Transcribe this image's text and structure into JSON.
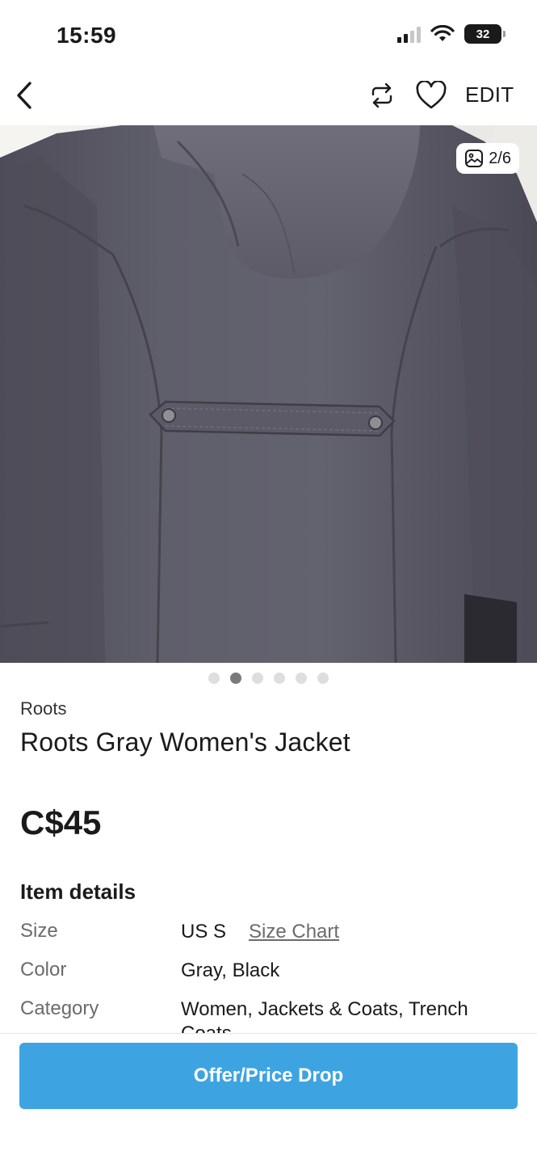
{
  "status_bar": {
    "time": "15:59",
    "battery": "32"
  },
  "nav": {
    "edit_label": "EDIT"
  },
  "gallery": {
    "counter": "2/6",
    "total_images": 6,
    "active_index": 2
  },
  "listing": {
    "brand": "Roots",
    "title": "Roots Gray Women's Jacket",
    "price": "C$45"
  },
  "item_details": {
    "title": "Item details",
    "size_label": "Size",
    "size_value": "US S",
    "size_chart_link": "Size Chart",
    "color_label": "Color",
    "color_value": "Gray, Black",
    "category_label": "Category",
    "category_value": "Women, Jackets & Coats, Trench Coats"
  },
  "actions": {
    "offer_button": "Offer/Price Drop"
  },
  "colors": {
    "accent": "#3ea4e1",
    "jacket": "#5a5966"
  },
  "icons": [
    "back-chevron-icon",
    "share-icon",
    "heart-icon",
    "gallery-icon",
    "wifi-icon",
    "signal-icon",
    "battery-icon"
  ]
}
